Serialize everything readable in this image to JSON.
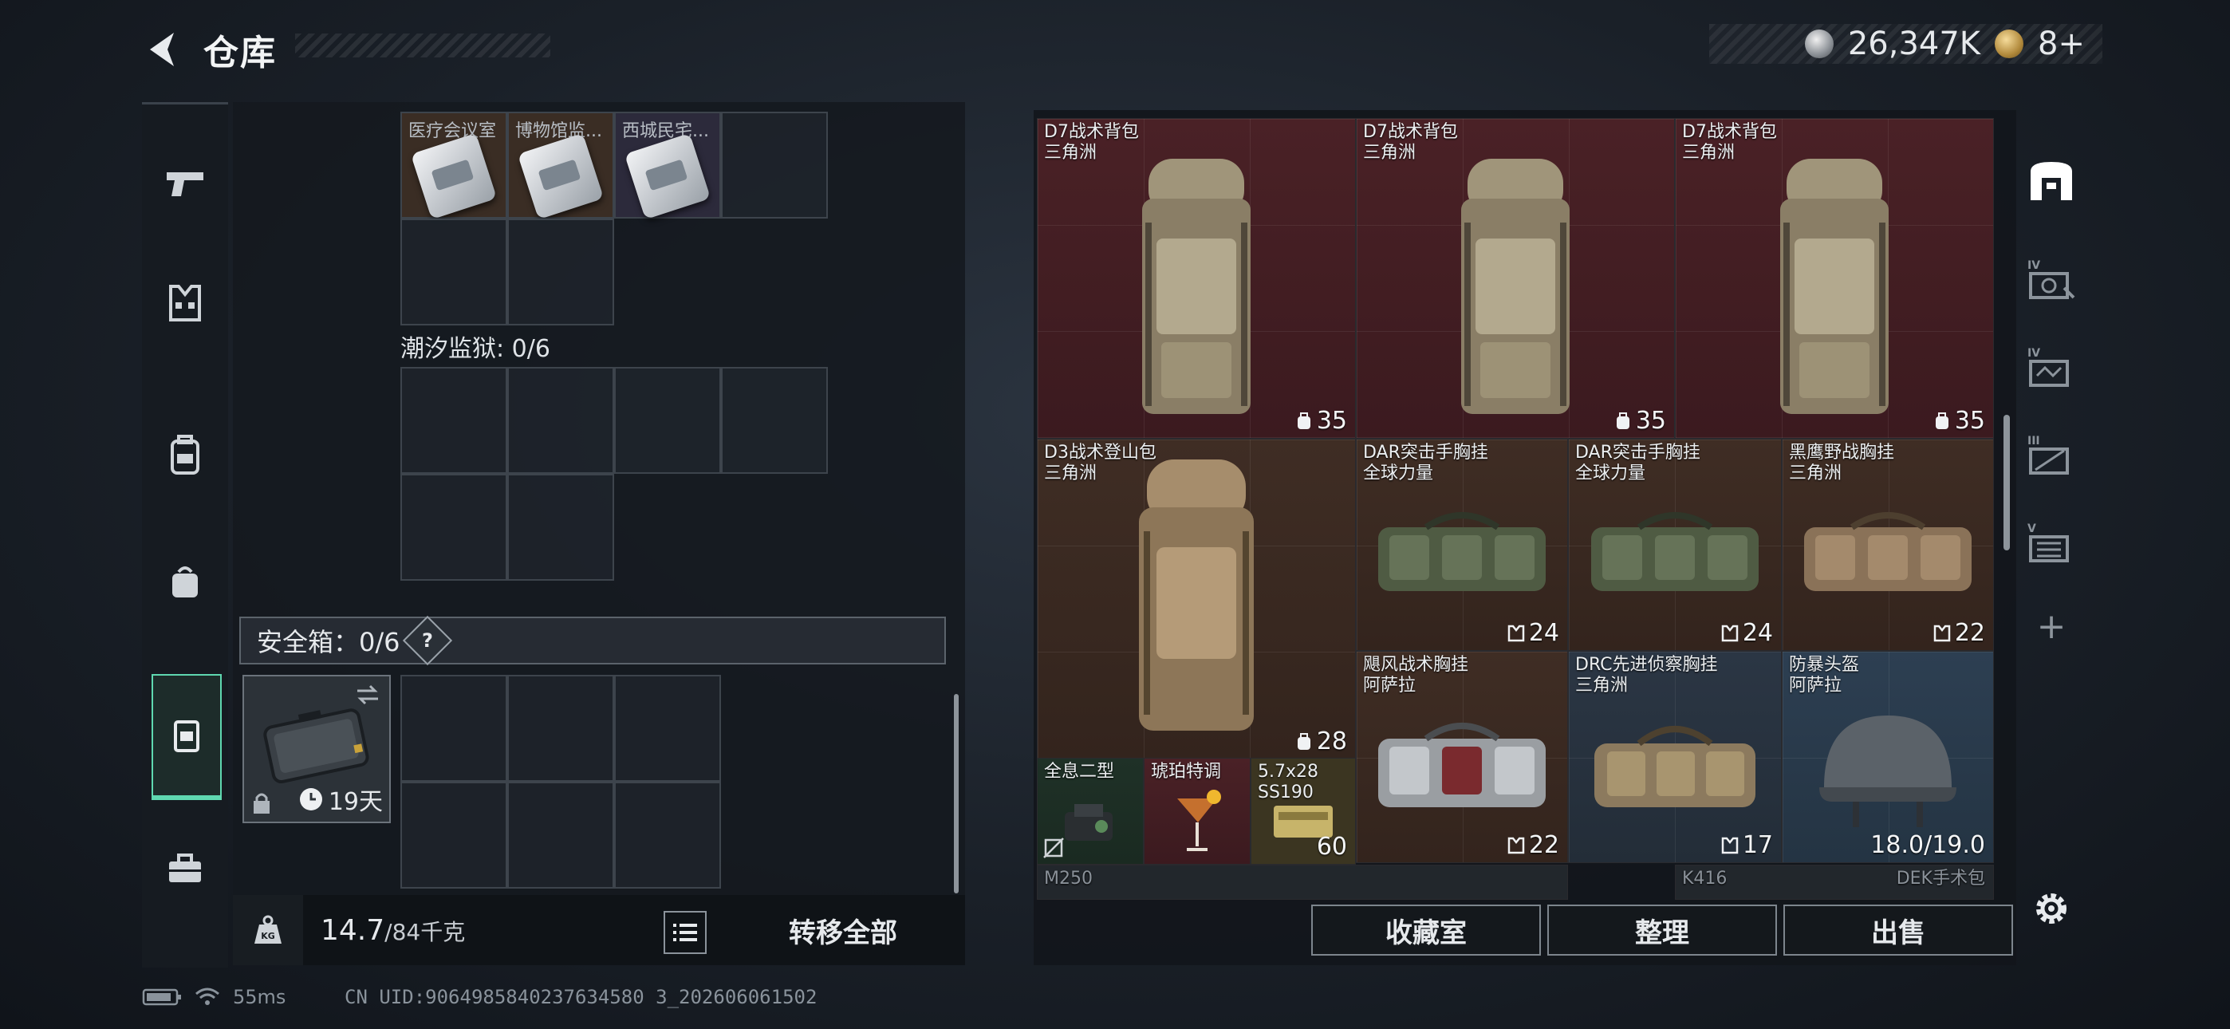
{
  "header": {
    "title": "仓库",
    "currency_amount": "26,347K",
    "tickets": "8+"
  },
  "left": {
    "key_cards": [
      {
        "label": "医疗会议室"
      },
      {
        "label": "博物馆监..."
      },
      {
        "label": "西城民宅..."
      }
    ],
    "prison_section": "潮汐监狱: 0/6",
    "safe_box_title": "安全箱：0/6",
    "help": "?",
    "safe_box_days": "19天",
    "weight_value": "14.7",
    "weight_max": "/84千克",
    "transfer_all": "转移全部"
  },
  "items": [
    {
      "name": "D7战术背包",
      "brand": "三角洲",
      "count": "35"
    },
    {
      "name": "D7战术背包",
      "brand": "三角洲",
      "count": "35"
    },
    {
      "name": "D7战术背包",
      "brand": "三角洲",
      "count": "35"
    },
    {
      "name": "D3战术登山包",
      "brand": "三角洲",
      "count": "28"
    },
    {
      "name": "DAR突击手胸挂",
      "brand": "全球力量",
      "count": "24"
    },
    {
      "name": "DAR突击手胸挂",
      "brand": "全球力量",
      "count": "24"
    },
    {
      "name": "黑鹰野战胸挂",
      "brand": "三角洲",
      "count": "22"
    },
    {
      "name": "飓风战术胸挂",
      "brand": "阿萨拉",
      "count": "22"
    },
    {
      "name": "DRC先进侦察胸挂",
      "brand": "三角洲",
      "count": "17"
    },
    {
      "name": "防暴头盔",
      "brand": "阿萨拉",
      "count": "18.0/19.0"
    },
    {
      "name": "全息二型",
      "brand": "",
      "count": ""
    },
    {
      "name": "琥珀特调",
      "brand": "",
      "count": ""
    },
    {
      "name": "5.7x28",
      "brand": "SS190",
      "count": "60"
    }
  ],
  "partial_row": [
    "M250",
    "K416",
    "DEK手术包"
  ],
  "buttons": {
    "collection": "收藏室",
    "sort": "整理",
    "sell": "出售"
  },
  "right_rail": {
    "plus": "+"
  },
  "status": {
    "ping": "55ms",
    "uid": "CN UID:9064985840237634580 3_202606061502"
  },
  "colors": {
    "accent": "#5fd8b0",
    "red_rarity": "#4a2126",
    "brown_rarity": "#3f2d24",
    "blue_rarity": "#2d3f52"
  }
}
